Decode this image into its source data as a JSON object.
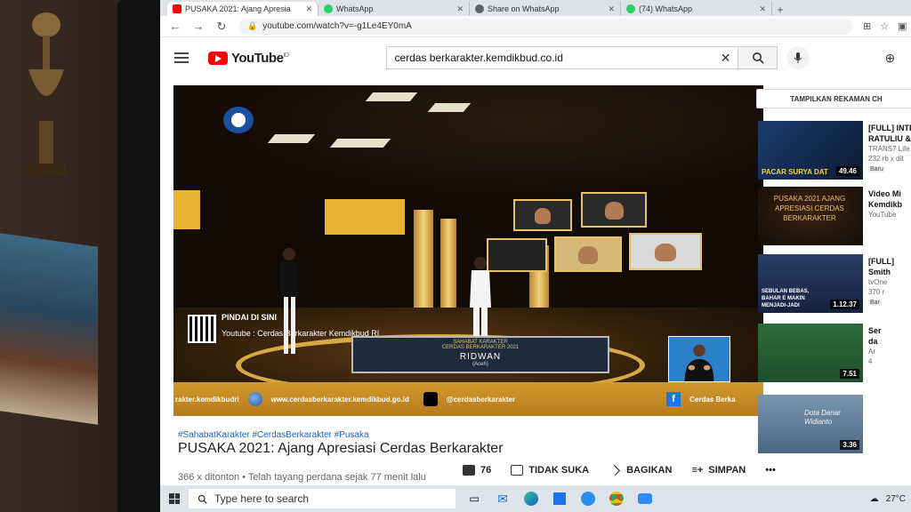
{
  "browser": {
    "tabs": [
      {
        "label": "PUSAKA 2021: Ajang Apresia",
        "icon": "youtube-icon",
        "close": "✕"
      },
      {
        "label": "WhatsApp",
        "icon": "whatsapp-icon",
        "close": "✕"
      },
      {
        "label": "Share on WhatsApp",
        "icon": "globe-icon",
        "close": "✕"
      },
      {
        "label": "(74) WhatsApp",
        "icon": "whatsapp-icon",
        "close": "✕"
      }
    ],
    "url": "youtube.com/watch?v=-g1Le4EY0mA"
  },
  "youtube": {
    "logo_text": "YouTube",
    "logo_region": "ID",
    "search_value": "cerdas berkarakter.kemdikbud.co.id"
  },
  "video_overlay": {
    "promo_title": "PINDAI DI SINI",
    "promo_sub": "Youtube : Cerdas Berkarakter Kemdikbud RI",
    "lower_third_sub": "SAHABAT KARAKTER",
    "lower_third_event": "CERDAS BERKARAKTER 2021",
    "lower_third_name": "RIDWAN",
    "lower_third_region": "(Aceh)",
    "ticker_left": "rakter.kemdikbudri",
    "ticker_site": "www.cerdasberkarakter.kemdikbud.go.id",
    "ticker_tiktok": "@cerdasberkarakter",
    "ticker_fb": "Cerdas Berka"
  },
  "video_info": {
    "hashtags": "#SahabatKarakter #CerdasBerkarakter #Pusaka",
    "title": "PUSAKA 2021: Ajang Apresiasi Cerdas Berkarakter",
    "meta": "366 x ditonton • Telah tayang perdana sejak 77 menit lalu",
    "likes": "76",
    "dislike_label": "TIDAK SUKA",
    "share_label": "BAGIKAN",
    "save_label": "SIMPAN",
    "more": "•••"
  },
  "sidebar": {
    "chat_button": "TAMPILKAN REKAMAN CH",
    "items": [
      {
        "title": "[FULL] INTE",
        "title2": "RATULIU &",
        "channel": "TRANS7 Life",
        "stats": "232 rb x dit",
        "badge": "Baru",
        "duration": "49.46",
        "thumb_text": "PACAR SURYA DAT"
      },
      {
        "title": "Video Mi",
        "title2": "Kemdikb",
        "channel": "YouTube",
        "stats": "",
        "badge": "",
        "duration": "",
        "thumb_text": "PUSAKA 2021 AJANG APRESIASI CERDAS BERKARAKTER"
      },
      {
        "title": "[FULL]",
        "title2": "Smith",
        "channel": "tvOne",
        "stats": "370 r",
        "badge": "Bar",
        "duration": "1.12.37",
        "thumb_text": "SEBULAN BEBAS, BAHAR E MAKIN MENJADI-JADI"
      },
      {
        "title": "Ser",
        "title2": "da",
        "channel": "Ar",
        "stats": "4",
        "badge": "",
        "duration": "7.51",
        "thumb_text": ""
      },
      {
        "title": "",
        "title2": "",
        "channel": "",
        "stats": "",
        "badge": "",
        "duration": "3.36",
        "thumb_text": "Dota Danar Widianto"
      }
    ]
  },
  "taskbar": {
    "search_placeholder": "Type here to search",
    "temperature": "27°C"
  }
}
